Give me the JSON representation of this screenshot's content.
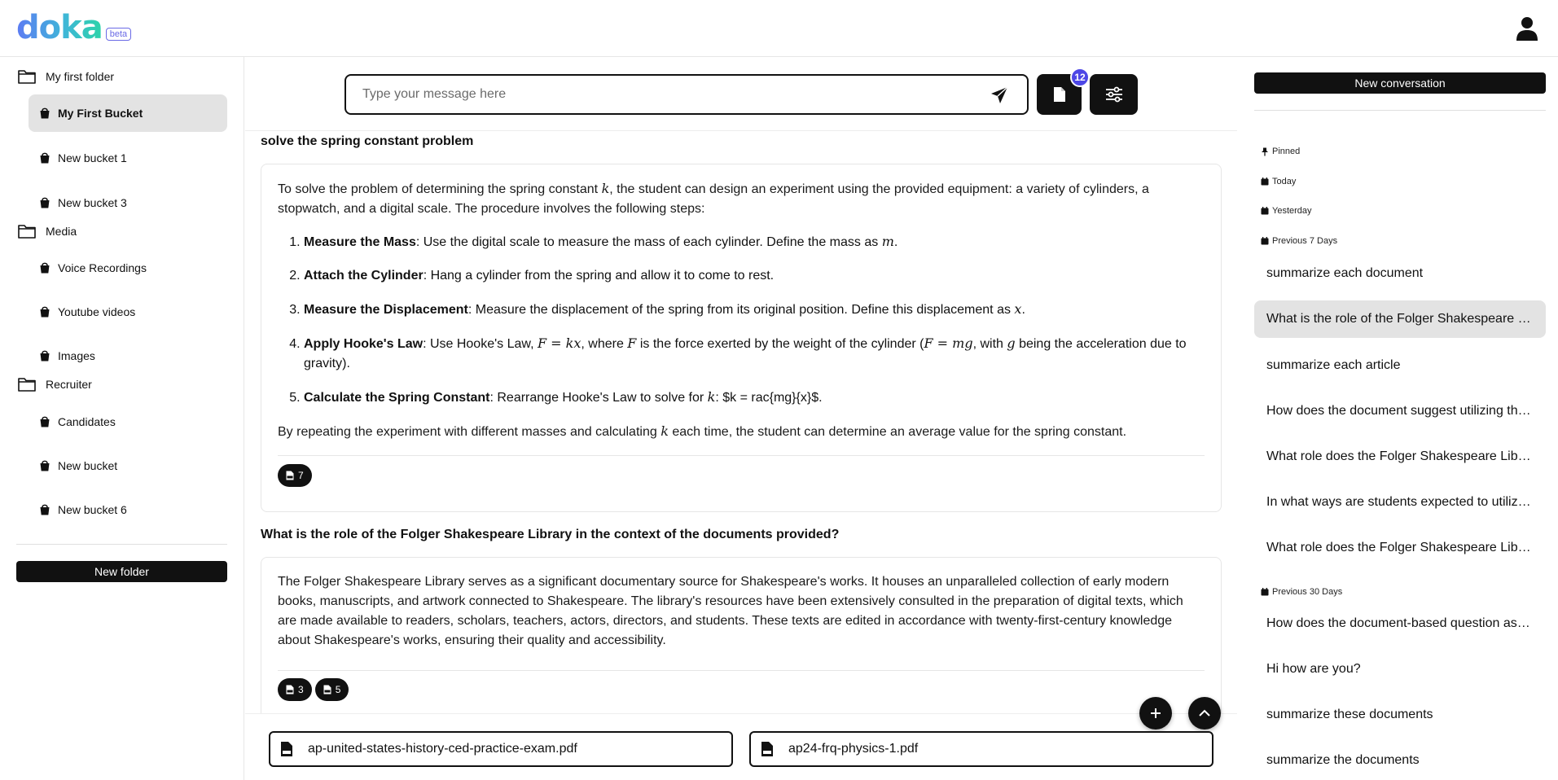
{
  "app": {
    "logo": "doka",
    "beta": "beta"
  },
  "sidebar": {
    "folders": [
      {
        "label": "My first folder",
        "buckets": [
          "My First Bucket",
          "New bucket 1",
          "New bucket 3"
        ]
      },
      {
        "label": "Media",
        "buckets": [
          "Voice Recordings",
          "Youtube videos",
          "Images"
        ]
      },
      {
        "label": "Recruiter",
        "buckets": [
          "Candidates",
          "New bucket",
          "New bucket 6"
        ]
      }
    ],
    "active_bucket": "My First Bucket",
    "new_folder_label": "New folder"
  },
  "chat": {
    "input_placeholder": "Type your message here",
    "documents_count": "12",
    "messages": [
      {
        "question": "solve the spring constant problem",
        "intro_a": "To solve the problem of determining the spring constant ",
        "intro_k": "k",
        "intro_b": ", the student can design an experiment using the provided equipment: a variety of cylinders, a stopwatch, and a digital scale. The procedure involves the following steps:",
        "steps": [
          {
            "title": "Measure the Mass",
            "text_a": ": Use the digital scale to measure the mass of each cylinder. Define the mass as ",
            "math1": "m",
            "text_b": "."
          },
          {
            "title": "Attach the Cylinder",
            "text_a": ": Hang a cylinder from the spring and allow it to come to rest."
          },
          {
            "title": "Measure the Displacement",
            "text_a": ": Measure the displacement of the spring from its original position. Define this displacement as ",
            "math1": "x",
            "text_b": "."
          },
          {
            "title": "Apply Hooke's Law",
            "text_a": ": Use Hooke's Law, ",
            "math1": "F = kx",
            "text_b": ", where ",
            "math2": "F",
            "text_c": " is the force exerted by the weight of the cylinder (",
            "math3": "F = mg",
            "text_d": ", with ",
            "math4": "g",
            "text_e": " being the acceleration due to gravity)."
          },
          {
            "title": "Calculate the Spring Constant",
            "text_a": ": Rearrange Hooke's Law to solve for ",
            "math1": "k",
            "text_b": ": $k =  rac{mg}{x}$."
          }
        ],
        "outro_a": "By repeating the experiment with different masses and calculating ",
        "outro_k": "k",
        "outro_b": " each time, the student can determine an average value for the spring constant.",
        "sources": [
          "7"
        ]
      },
      {
        "question": "What is the role of the Folger Shakespeare Library in the context of the documents provided?",
        "answer": "The Folger Shakespeare Library serves as a significant documentary source for Shakespeare's works. It houses an unparalleled collection of early modern books, manuscripts, and artwork connected to Shakespeare. The library's resources have been extensively consulted in the preparation of digital texts, which are made available to readers, scholars, teachers, actors, directors, and students. These texts are edited in accordance with twenty-first-century knowledge about Shakespeare's works, ensuring their quality and accessibility.",
        "sources": [
          "3",
          "5"
        ]
      }
    ],
    "attached_files": [
      "ap-united-states-history-ced-practice-exam.pdf",
      "ap24-frq-physics-1.pdf"
    ]
  },
  "conversations": {
    "new_label": "New conversation",
    "sections": {
      "pinned": "Pinned",
      "today": "Today",
      "yesterday": "Yesterday",
      "prev7": "Previous 7 Days",
      "prev30": "Previous 30 Days"
    },
    "prev7_items": [
      "summarize each document",
      "What is the role of the Folger Shakespeare Library in the context of the documents provided?",
      "summarize each article",
      "How does the document suggest utilizing the resources?",
      "What role does the Folger Shakespeare Library play?",
      "In what ways are students expected to utilize the documents?",
      "What role does the Folger Shakespeare Library have?"
    ],
    "prev30_items": [
      "How does the document-based question assess students?",
      "Hi how are you?",
      "summarize these documents",
      "summarize the documents"
    ],
    "active_index": 1
  }
}
